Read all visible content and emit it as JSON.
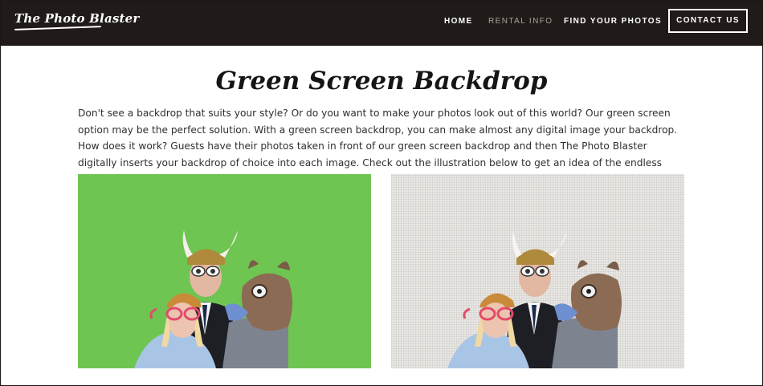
{
  "header": {
    "logo_text": "The Photo Blaster",
    "nav": {
      "home": "HOME",
      "rental_info": "RENTAL INFO",
      "find_photos": "FIND YOUR PHOTOS",
      "contact": "CONTACT US"
    }
  },
  "main": {
    "title": "Green Screen Backdrop",
    "intro": "Don't see a backdrop that suits your style? Or do you want to make your photos look out of this world? Our green screen option may be the perfect solution. With a green screen backdrop, you can make almost any digital image your backdrop. How does it work? Guests have their photos taken in front of our green screen backdrop and then The Photo Blaster digitally inserts your backdrop of choice into each image. Check out the illustration below to get an idea of the endless possibilities."
  },
  "colors": {
    "header_bg": "#201b19",
    "green_screen": "#6fc551",
    "backdrop_gray": "#e9e7e3"
  }
}
